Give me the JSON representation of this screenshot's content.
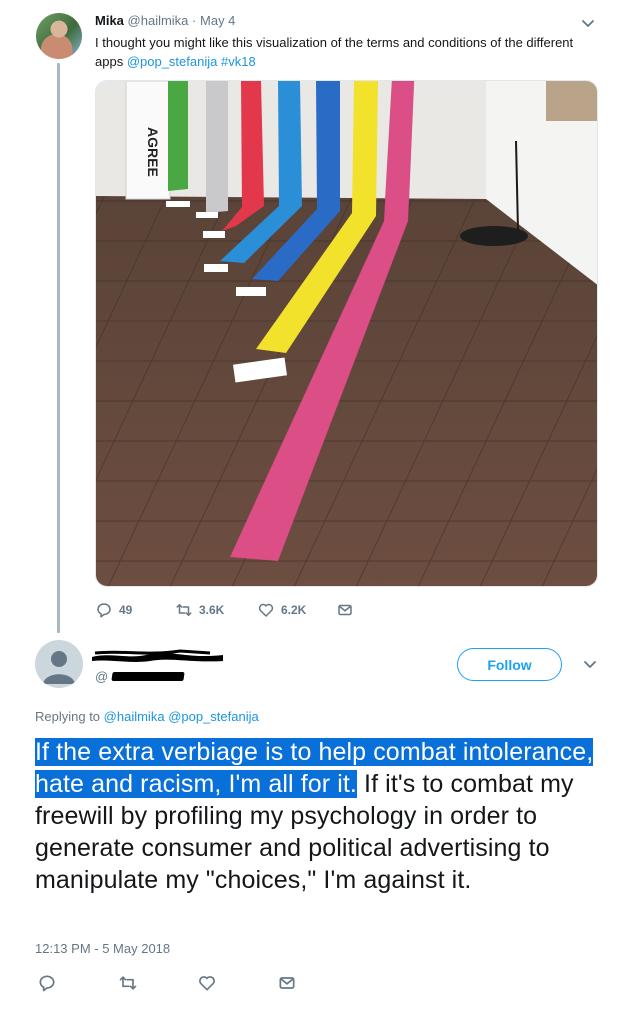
{
  "original_tweet": {
    "author_name": "Mika",
    "handle": "@hailmika",
    "separator": "·",
    "date": "May 4",
    "text_plain": "I thought you might like this visualization of the terms and conditions of the different apps ",
    "mention": "@pop_stefanija",
    "hashtag": "#vk18",
    "photo_sign_text": "AGREE",
    "actions": {
      "replies": "49",
      "retweets": "3.6K",
      "likes": "6.2K"
    }
  },
  "reply_tweet": {
    "follow_label": "Follow",
    "handle_prefix": "@",
    "replying_label": "Replying to",
    "replying_mentions": [
      "@hailmika",
      "@pop_stefanija"
    ],
    "text_highlighted": "If the extra verbiage is to help combat intolerance, hate and racism, I'm all for it.",
    "text_rest": " If it's to combat my freewill by profiling my psychology in order to generate consumer and political advertising to manipulate my \"choices,\" I'm against it.",
    "timestamp": "12:13 PM - 5 May 2018"
  },
  "icons": [
    "reply-icon",
    "retweet-icon",
    "like-icon",
    "message-icon",
    "chevron-down-icon"
  ],
  "colors": {
    "link": "#1b95e0",
    "follow": "#1da1f2",
    "muted": "#657786",
    "text_selection": "#0a70d9"
  }
}
